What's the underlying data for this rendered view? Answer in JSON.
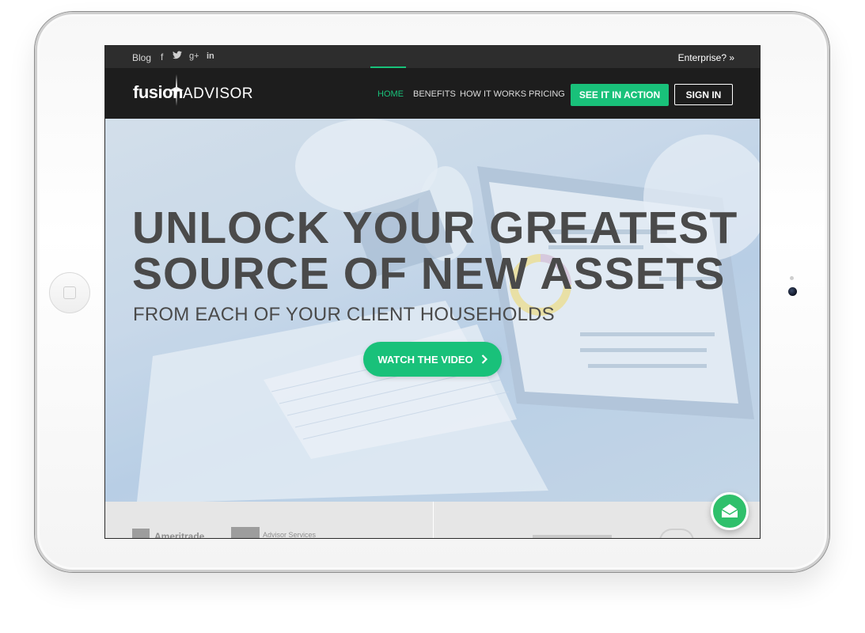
{
  "topbar": {
    "blog_label": "Blog",
    "social_icons": [
      "facebook-icon",
      "twitter-icon",
      "google-plus-icon",
      "linkedin-icon"
    ],
    "facebook_glyph": "f",
    "google_glyph": "g+",
    "linkedin_glyph": "in",
    "enterprise_label": "Enterprise? »"
  },
  "navbar": {
    "logo_part1": "fusion",
    "logo_part2": "ADVISOR",
    "links": [
      "HOME",
      "BENEFITS",
      "HOW IT WORKS",
      "PRICING"
    ],
    "active_link": "HOME",
    "cta_label": "SEE IT IN ACTION",
    "signin_label": "SIGN IN"
  },
  "hero": {
    "title_line1": "UNLOCK YOUR GREATEST",
    "title_line2": "SOURCE OF NEW ASSETS",
    "subtitle": "FROM EACH OF YOUR CLIENT HOUSEHOLDS",
    "video_button_label": "WATCH THE VIDEO"
  },
  "partners": {
    "left_logo_1": "Ameritrade",
    "left_logo_2": "Advisor Services"
  },
  "colors": {
    "accent": "#19c17a",
    "nav_bg": "#1d1d1d",
    "topbar_bg": "#2d2d2d",
    "hero_text": "#4a4a4a"
  }
}
